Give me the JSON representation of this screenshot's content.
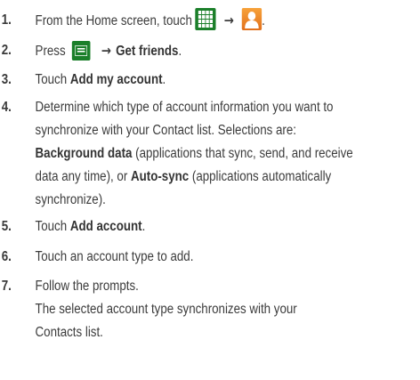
{
  "steps": [
    {
      "num": "1.",
      "before": "From the Home screen, touch",
      "after": "."
    },
    {
      "num": "2.",
      "before": "Press",
      "bold": "Get friends",
      "after": "."
    },
    {
      "num": "3.",
      "before": "Touch ",
      "bold": "Add my account",
      "after": "."
    },
    {
      "num": "4.",
      "line1": "Determine which type of account information you want to",
      "line2": "synchronize with your Contact list. Selections are:",
      "line3_bold": "Background data",
      "line3_rest": " (applications that sync, send, and receive",
      "line4_pre": "data any time), or ",
      "line4_bold": "Auto-sync",
      "line4_rest": " (applications automatically",
      "line5": "synchronize)."
    },
    {
      "num": "5.",
      "before": "Touch ",
      "bold": "Add account",
      "after": "."
    },
    {
      "num": "6.",
      "text": "Touch an account type to add."
    },
    {
      "num": "7.",
      "text": "Follow the prompts.",
      "note1": "The selected account type synchronizes with your",
      "note2": "Contacts list."
    }
  ],
  "arrow_glyph": "→",
  "icons": [
    "apps-grid-icon",
    "contacts-icon",
    "menu-icon"
  ]
}
